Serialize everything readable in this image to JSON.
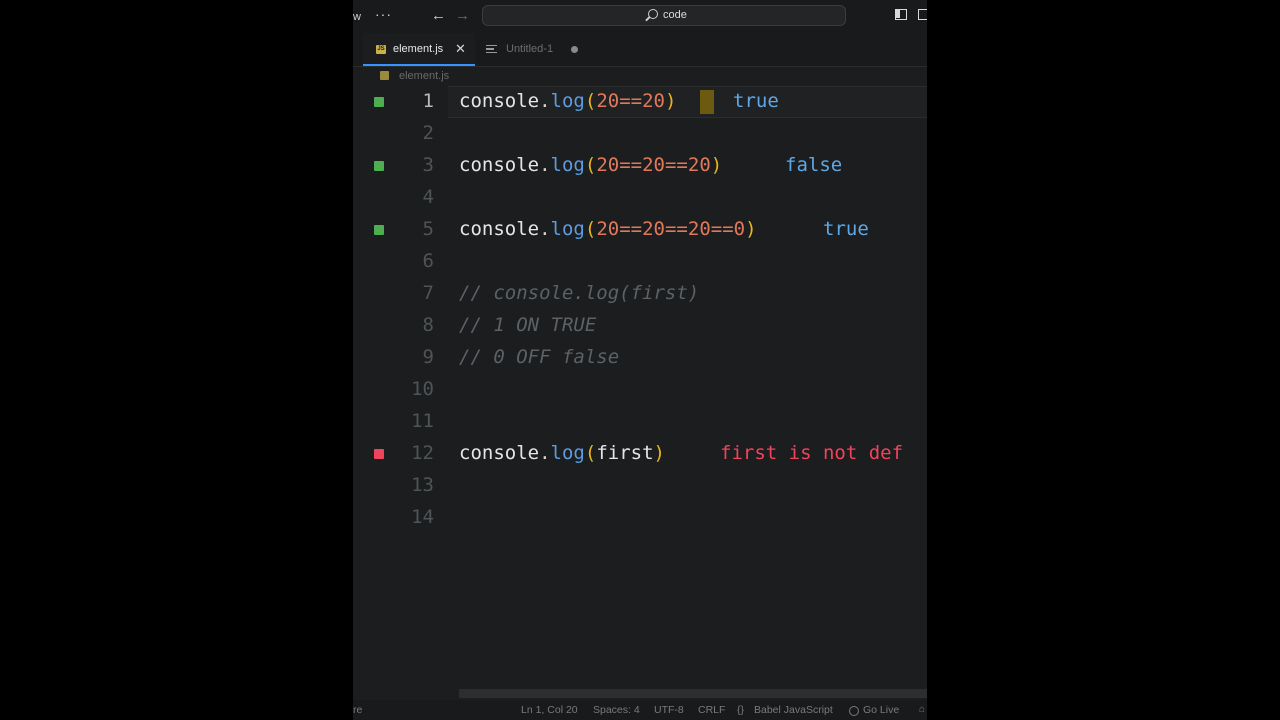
{
  "titlebar": {
    "edge_text": "w",
    "more_glyph": "···",
    "back_glyph": "←",
    "forward_glyph": "→",
    "search_text": "code"
  },
  "tabs": [
    {
      "label": "element.js",
      "badge": "JS",
      "close": "✕",
      "active": true
    },
    {
      "label": "Untitled-1",
      "active": false,
      "unsaved": true
    }
  ],
  "breadcrumb": {
    "file": "element.js"
  },
  "editor": {
    "lines": [
      {
        "num": "1"
      },
      {
        "num": "2"
      },
      {
        "num": "3"
      },
      {
        "num": "4"
      },
      {
        "num": "5"
      },
      {
        "num": "6"
      },
      {
        "num": "7",
        "comment": "// console.log(first)"
      },
      {
        "num": "8",
        "comment": "// 1 ON TRUE"
      },
      {
        "num": "9",
        "comment": "// 0 OFF false"
      },
      {
        "num": "10"
      },
      {
        "num": "11"
      },
      {
        "num": "12"
      },
      {
        "num": "13"
      },
      {
        "num": "14"
      }
    ],
    "code1": {
      "obj": "console",
      "dot": ".",
      "fn": "log",
      "open": "(",
      "a": "20",
      "op": "==",
      "b": "20",
      "close": ")",
      "result": "true"
    },
    "code3": {
      "obj": "console",
      "dot": ".",
      "fn": "log",
      "open": "(",
      "a": "20",
      "op1": "==",
      "b": "20",
      "op2": "==",
      "c": "20",
      "close": ")",
      "result": "false"
    },
    "code5": {
      "obj": "console",
      "dot": ".",
      "fn": "log",
      "open": "(",
      "a": "20",
      "op1": "==",
      "b": "20",
      "op2": "==",
      "c": "20",
      "op3": "==",
      "d": "0",
      "close": ")",
      "result": "true"
    },
    "code12": {
      "obj": "console",
      "dot": ".",
      "fn": "log",
      "open": "(",
      "arg": "first",
      "close": ")",
      "result": "first is not def"
    }
  },
  "statusbar": {
    "edge_text": "re",
    "position": "Ln 1, Col 20",
    "spaces": "Spaces: 4",
    "encoding": "UTF-8",
    "eol": "CRLF",
    "language": "Babel JavaScript",
    "golive": "Go Live"
  },
  "colors": {
    "keyword_fn": "#5e9be0",
    "number": "#e0795a",
    "paren": "#e6b422",
    "comment": "#5c6166",
    "ok_result": "#5ea8e8",
    "error_result": "#f0445c",
    "ok_marker": "#4caf50",
    "accent": "#3794ff"
  }
}
